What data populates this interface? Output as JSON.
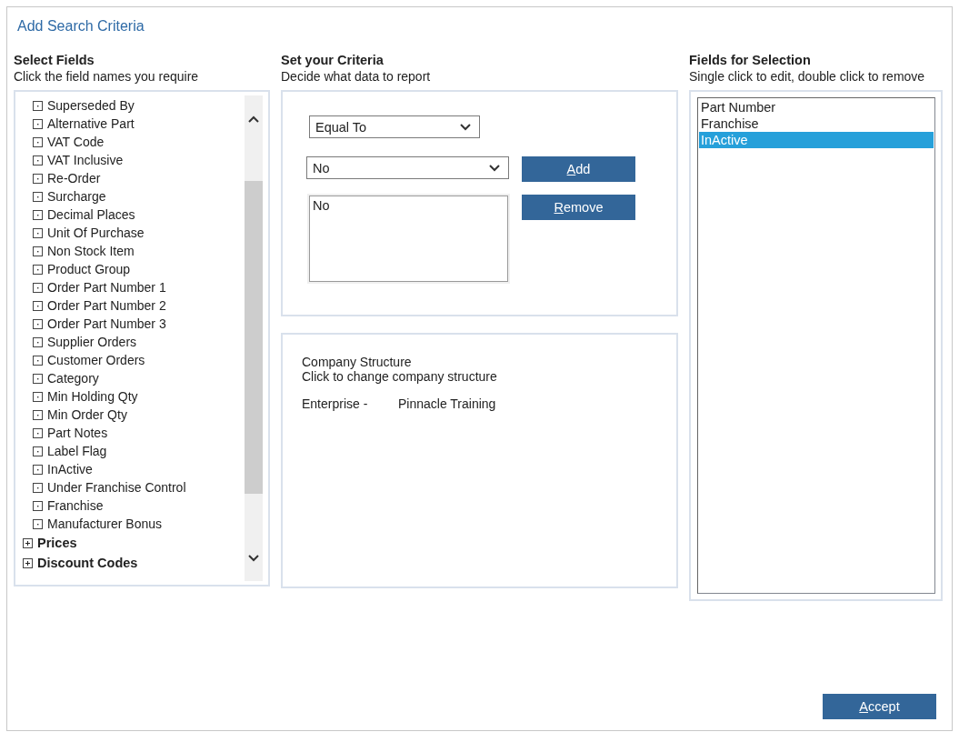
{
  "dialog": {
    "title": "Add Search Criteria"
  },
  "select_fields": {
    "heading": "Select Fields",
    "hint": "Click the field names you require",
    "tree": [
      {
        "label": "Superseded By",
        "kind": "leaf"
      },
      {
        "label": "Alternative Part",
        "kind": "leaf"
      },
      {
        "label": "VAT Code",
        "kind": "leaf"
      },
      {
        "label": "VAT Inclusive",
        "kind": "leaf"
      },
      {
        "label": "Re-Order",
        "kind": "leaf"
      },
      {
        "label": "Surcharge",
        "kind": "leaf"
      },
      {
        "label": "Decimal Places",
        "kind": "leaf"
      },
      {
        "label": "Unit Of Purchase",
        "kind": "leaf"
      },
      {
        "label": "Non Stock Item",
        "kind": "leaf"
      },
      {
        "label": "Product Group",
        "kind": "leaf"
      },
      {
        "label": "Order Part Number 1",
        "kind": "leaf"
      },
      {
        "label": "Order Part Number 2",
        "kind": "leaf"
      },
      {
        "label": "Order Part Number 3",
        "kind": "leaf"
      },
      {
        "label": "Supplier Orders",
        "kind": "leaf"
      },
      {
        "label": "Customer Orders",
        "kind": "leaf"
      },
      {
        "label": "Category",
        "kind": "leaf"
      },
      {
        "label": "Min Holding Qty",
        "kind": "leaf"
      },
      {
        "label": "Min Order Qty",
        "kind": "leaf"
      },
      {
        "label": "Part Notes",
        "kind": "leaf"
      },
      {
        "label": "Label Flag",
        "kind": "leaf"
      },
      {
        "label": "InActive",
        "kind": "leaf"
      },
      {
        "label": "Under Franchise Control",
        "kind": "leaf"
      },
      {
        "label": "Franchise",
        "kind": "leaf"
      },
      {
        "label": "Manufacturer Bonus",
        "kind": "leaf"
      },
      {
        "label": "Prices",
        "kind": "group",
        "expanded": false
      },
      {
        "label": "Discount Codes",
        "kind": "group",
        "expanded": false
      }
    ]
  },
  "criteria": {
    "heading": "Set your Criteria",
    "hint": "Decide what data to report",
    "operator": {
      "value": "Equal To"
    },
    "value_select": {
      "value": "No"
    },
    "values_list": [
      "No"
    ],
    "buttons": [
      {
        "label": "Add"
      },
      {
        "label": "Remove"
      }
    ]
  },
  "company_structure": {
    "title": "Company Structure",
    "hint": "Click to change company structure",
    "label": "Enterprise -",
    "value": "Pinnacle Training"
  },
  "fields_for_selection": {
    "heading": "Fields for Selection",
    "hint": "Single click to edit, double click to remove",
    "items": [
      {
        "label": "Part Number",
        "selected": false
      },
      {
        "label": "Franchise",
        "selected": false
      },
      {
        "label": "InActive",
        "selected": true
      }
    ]
  },
  "accept_button": {
    "label": "Accept"
  }
}
